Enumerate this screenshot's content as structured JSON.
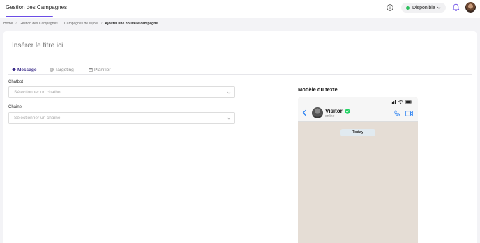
{
  "header": {
    "app_title": "Gestion des Campagnes",
    "status_label": "Disponible",
    "accent_color": "#6b4de6",
    "status_color": "#2bbf5c"
  },
  "breadcrumb": [
    "Home",
    "Gestion des Campagnes",
    "Campagnes de séjour",
    "Ajouter une nouvelle campagne"
  ],
  "form": {
    "title_placeholder": "Insérer le titre ici",
    "tabs": [
      {
        "label": "Message",
        "icon": "chat-icon",
        "active": true
      },
      {
        "label": "Targeting",
        "icon": "target-icon",
        "active": false
      },
      {
        "label": "Planifier",
        "icon": "calendar-icon",
        "active": false
      }
    ],
    "chatbot_label": "Chatbot",
    "chatbot_placeholder": "Sélectionner un chatbot",
    "chaine_label": "Chaine",
    "chaine_placeholder": "Sélectionner un chaîne"
  },
  "preview": {
    "title": "Modèle du texte",
    "contact_name": "Visitor",
    "contact_status": "online",
    "date_chip": "Today"
  }
}
